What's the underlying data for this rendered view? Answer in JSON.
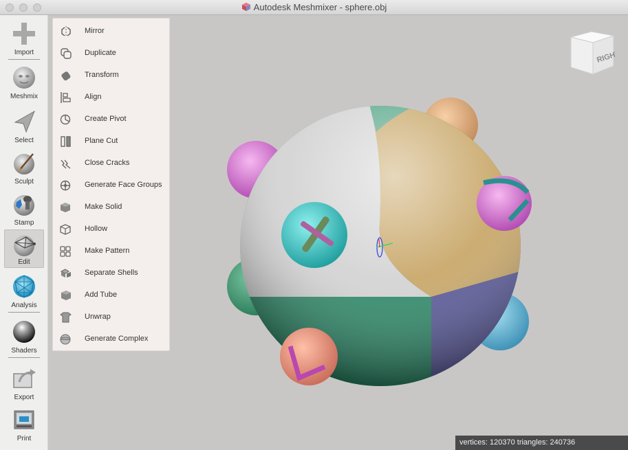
{
  "window": {
    "title": "Autodesk Meshmixer - sphere.obj"
  },
  "toolbar": {
    "items": [
      {
        "label": "Import",
        "icon": "plus-icon"
      },
      {
        "label": "Meshmix",
        "icon": "meshmix-head-icon"
      },
      {
        "label": "Select",
        "icon": "select-arrow-icon"
      },
      {
        "label": "Sculpt",
        "icon": "sculpt-brush-icon"
      },
      {
        "label": "Stamp",
        "icon": "stamp-icon"
      },
      {
        "label": "Edit",
        "icon": "edit-mesh-icon"
      },
      {
        "label": "Analysis",
        "icon": "analysis-icon"
      },
      {
        "label": "Shaders",
        "icon": "shaders-sphere-icon"
      },
      {
        "label": "Export",
        "icon": "export-icon"
      },
      {
        "label": "Print",
        "icon": "print-icon"
      }
    ],
    "active": "Edit"
  },
  "edit_menu": {
    "items": [
      {
        "label": "Mirror",
        "icon": "mirror-icon"
      },
      {
        "label": "Duplicate",
        "icon": "duplicate-icon"
      },
      {
        "label": "Transform",
        "icon": "transform-icon"
      },
      {
        "label": "Align",
        "icon": "align-icon"
      },
      {
        "label": "Create Pivot",
        "icon": "create-pivot-icon"
      },
      {
        "label": "Plane Cut",
        "icon": "plane-cut-icon"
      },
      {
        "label": "Close Cracks",
        "icon": "close-cracks-icon"
      },
      {
        "label": "Generate Face Groups",
        "icon": "face-groups-icon"
      },
      {
        "label": "Make Solid",
        "icon": "make-solid-icon"
      },
      {
        "label": "Hollow",
        "icon": "hollow-icon"
      },
      {
        "label": "Make Pattern",
        "icon": "make-pattern-icon"
      },
      {
        "label": "Separate Shells",
        "icon": "separate-shells-icon"
      },
      {
        "label": "Add Tube",
        "icon": "add-tube-icon"
      },
      {
        "label": "Unwrap",
        "icon": "unwrap-icon"
      },
      {
        "label": "Generate Complex",
        "icon": "generate-complex-icon"
      }
    ]
  },
  "viewport": {
    "nav_cube_label": "RIGHT",
    "status": "vertices: 120370 triangles: 240736"
  }
}
